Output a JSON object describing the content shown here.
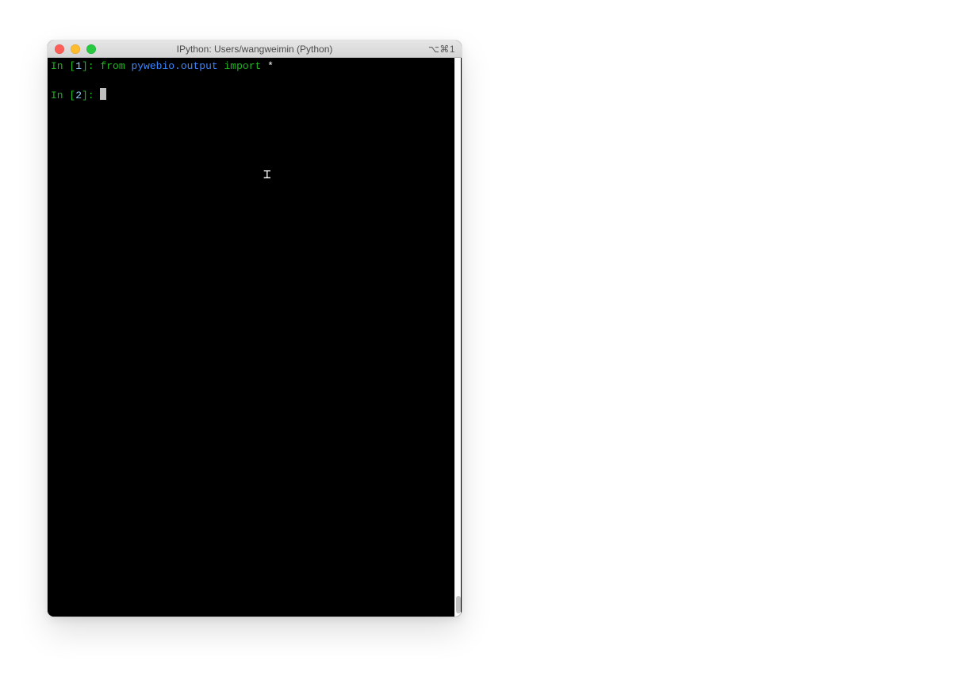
{
  "window": {
    "title": "IPython: Users/wangweimin (Python)",
    "shortcut_indicator": "⌥⌘1"
  },
  "terminal": {
    "lines": [
      {
        "prompt_in": "In ",
        "bracket_open": "[",
        "num": "1",
        "bracket_close": "]: ",
        "kw_from": "from ",
        "module": "pywebio.output ",
        "kw_import": "import ",
        "star": "*"
      },
      {
        "prompt_in": "In ",
        "bracket_open": "[",
        "num": "2",
        "bracket_close": "]: "
      }
    ]
  }
}
